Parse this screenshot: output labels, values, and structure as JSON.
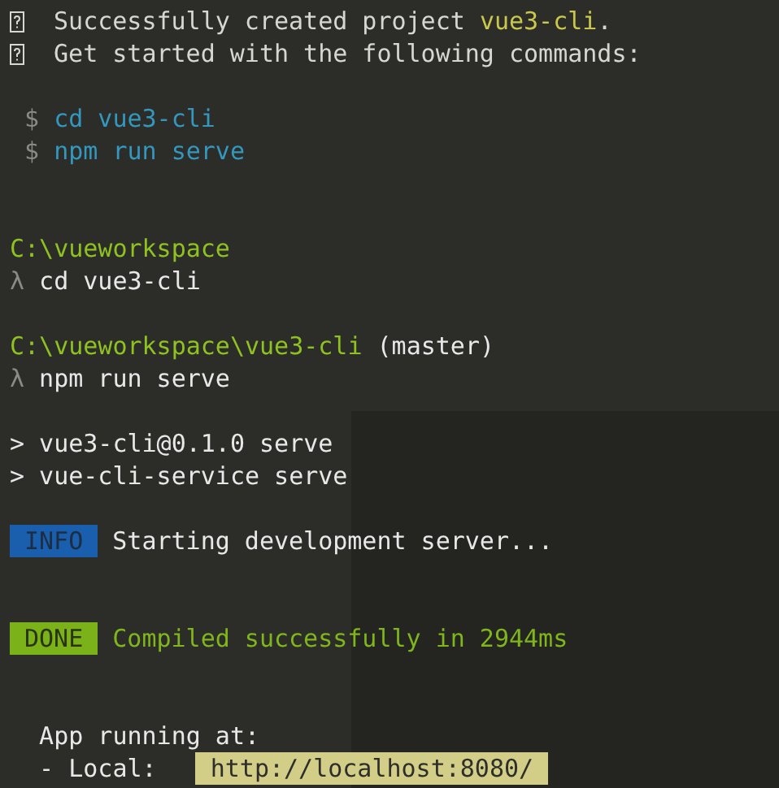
{
  "terminal": {
    "lines": [
      {
        "kind": "text",
        "segments": [
          {
            "kind": "glyph"
          },
          {
            "kind": "plain",
            "text": " Successfully created project "
          },
          {
            "kind": "accent",
            "text": "vue3-cli"
          },
          {
            "kind": "plain",
            "text": "."
          }
        ]
      },
      {
        "kind": "text",
        "segments": [
          {
            "kind": "glyph"
          },
          {
            "kind": "plain",
            "text": " Get started with the following commands:"
          }
        ]
      },
      {
        "kind": "blank"
      },
      {
        "kind": "text",
        "segments": [
          {
            "kind": "prompt",
            "text": " $"
          },
          {
            "kind": "command",
            "text": " cd vue3-cli"
          }
        ]
      },
      {
        "kind": "text",
        "segments": [
          {
            "kind": "prompt",
            "text": " $"
          },
          {
            "kind": "command",
            "text": " npm run serve"
          }
        ]
      },
      {
        "kind": "blank"
      },
      {
        "kind": "blank"
      },
      {
        "kind": "text",
        "segments": [
          {
            "kind": "path",
            "text": "C:\\vueworkspace"
          }
        ]
      },
      {
        "kind": "text",
        "segments": [
          {
            "kind": "prompt",
            "text": "λ"
          },
          {
            "kind": "bright",
            "text": " cd vue3-cli"
          }
        ]
      },
      {
        "kind": "blank"
      },
      {
        "kind": "text",
        "segments": [
          {
            "kind": "path",
            "text": "C:\\vueworkspace\\vue3-cli"
          },
          {
            "kind": "bright",
            "text": " (master)"
          }
        ]
      },
      {
        "kind": "text",
        "segments": [
          {
            "kind": "prompt",
            "text": "λ"
          },
          {
            "kind": "bright",
            "text": " npm run serve"
          }
        ]
      },
      {
        "kind": "blank"
      },
      {
        "kind": "text",
        "segments": [
          {
            "kind": "bright",
            "text": "> vue3-cli@0.1.0 serve"
          }
        ]
      },
      {
        "kind": "text",
        "segments": [
          {
            "kind": "bright",
            "text": "> vue-cli-service serve"
          }
        ]
      },
      {
        "kind": "blank"
      },
      {
        "kind": "text",
        "segments": [
          {
            "kind": "info-badge",
            "text": "INFO"
          },
          {
            "kind": "bright",
            "text": " Starting development server..."
          }
        ]
      },
      {
        "kind": "blank"
      },
      {
        "kind": "blank"
      },
      {
        "kind": "text",
        "segments": [
          {
            "kind": "done-badge",
            "text": "DONE"
          },
          {
            "kind": "success",
            "text": " Compiled successfully in 2944ms"
          }
        ]
      },
      {
        "kind": "blank"
      },
      {
        "kind": "blank"
      },
      {
        "kind": "text",
        "segments": [
          {
            "kind": "bright",
            "text": "  App running at:"
          }
        ]
      },
      {
        "kind": "text",
        "segments": [
          {
            "kind": "bright",
            "text": "  - Local:  "
          },
          {
            "kind": "url",
            "text": "http://localhost:8080/"
          }
        ]
      }
    ]
  }
}
